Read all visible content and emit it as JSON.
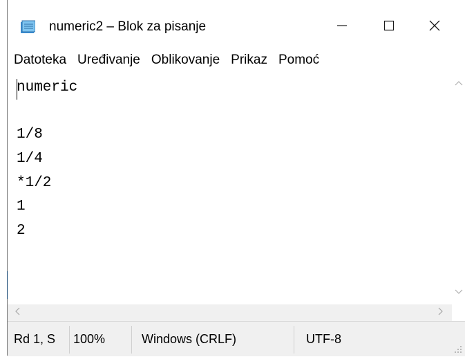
{
  "window": {
    "title": "numeric2 – Blok za pisanje",
    "app_icon": "notepad-icon",
    "controls": {
      "minimize_icon": "minimize-icon",
      "maximize_icon": "maximize-icon",
      "close_icon": "close-icon"
    }
  },
  "menu": {
    "items": [
      {
        "label": "Datoteka"
      },
      {
        "label": "Uređivanje"
      },
      {
        "label": "Oblikovanje"
      },
      {
        "label": "Prikaz"
      },
      {
        "label": "Pomoć"
      }
    ]
  },
  "editor": {
    "lines": [
      "numeric",
      "",
      "1/8",
      "1/4",
      "*1/2",
      "1",
      "2"
    ]
  },
  "scrollbars": {
    "up_icon": "chevron-up-icon",
    "down_icon": "chevron-down-icon",
    "left_icon": "chevron-left-icon",
    "right_icon": "chevron-right-icon"
  },
  "status": {
    "position": "Rd 1, S",
    "zoom": "100%",
    "line_ending": "Windows (CRLF)",
    "encoding": "UTF-8"
  }
}
